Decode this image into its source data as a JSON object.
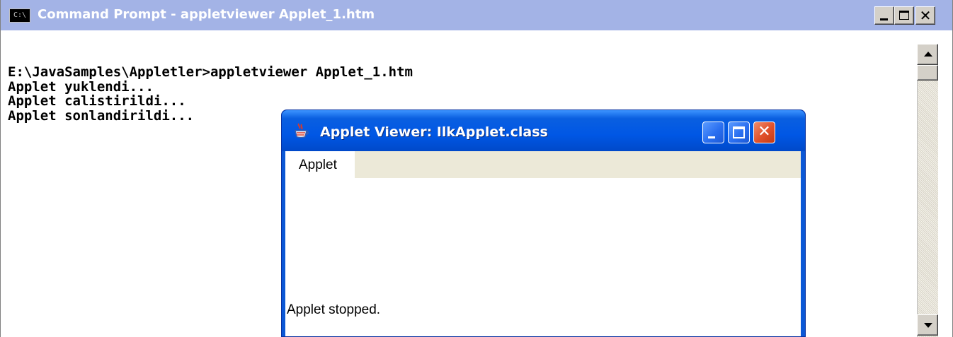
{
  "cmd_window": {
    "title": "Command Prompt - appletviewer Applet_1.htm",
    "icon_label": "C:\\",
    "buttons": {
      "minimize": "minimize-icon",
      "maximize": "maximize-icon",
      "close_glyph": "✕"
    },
    "console_lines": [
      "E:\\JavaSamples\\Appletler>appletviewer Applet_1.htm",
      "Applet yuklendi...",
      "Applet calistirildi...",
      "Applet sonlandirildi..."
    ]
  },
  "applet_window": {
    "title": "Applet Viewer: IlkApplet.class",
    "menu": [
      "Applet"
    ],
    "status": "Applet stopped.",
    "buttons": {
      "close_glyph": "✕"
    }
  },
  "colors": {
    "cmd_titlebar": "#a3b3e6",
    "xp_titlebar": "#0057e5",
    "xp_close": "#e0502a"
  }
}
